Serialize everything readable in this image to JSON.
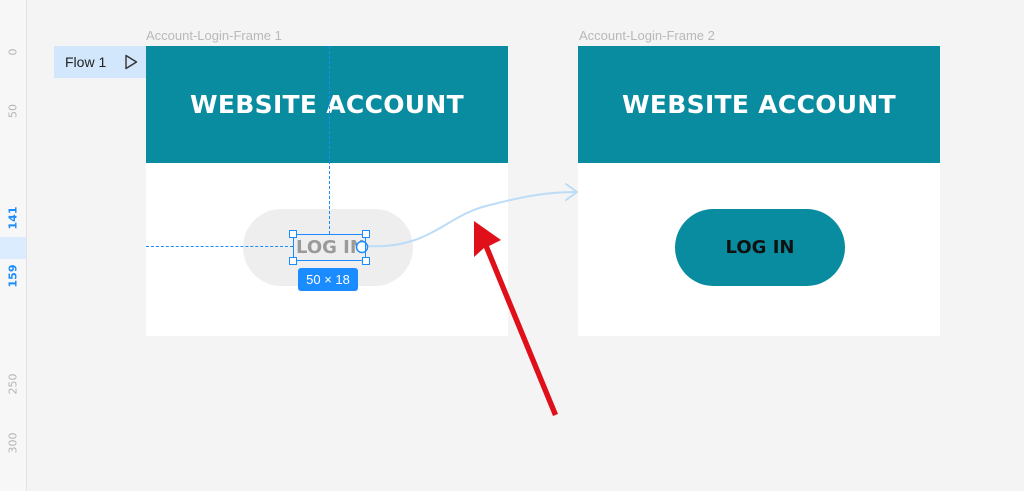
{
  "ruler": {
    "ticks": [
      "0",
      "50",
      "141",
      "159",
      "250",
      "300"
    ]
  },
  "flow": {
    "label": "Flow 1",
    "play_icon": "play-triangle-icon"
  },
  "frames": [
    {
      "label": "Account-Login-Frame 1",
      "title": "WEBSITE ACCOUNT",
      "button_label": "LOG IN"
    },
    {
      "label": "Account-Login-Frame 2",
      "title": "WEBSITE ACCOUNT",
      "button_label": "LOG IN"
    }
  ],
  "selection": {
    "size_badge": "50 × 18"
  },
  "colors": {
    "header": "#0a8ca0",
    "selection": "#1a8cff",
    "canvas": "#f4f4f4",
    "annotation_arrow": "#e0101a",
    "prototype_connector": "#bcdcf7"
  }
}
